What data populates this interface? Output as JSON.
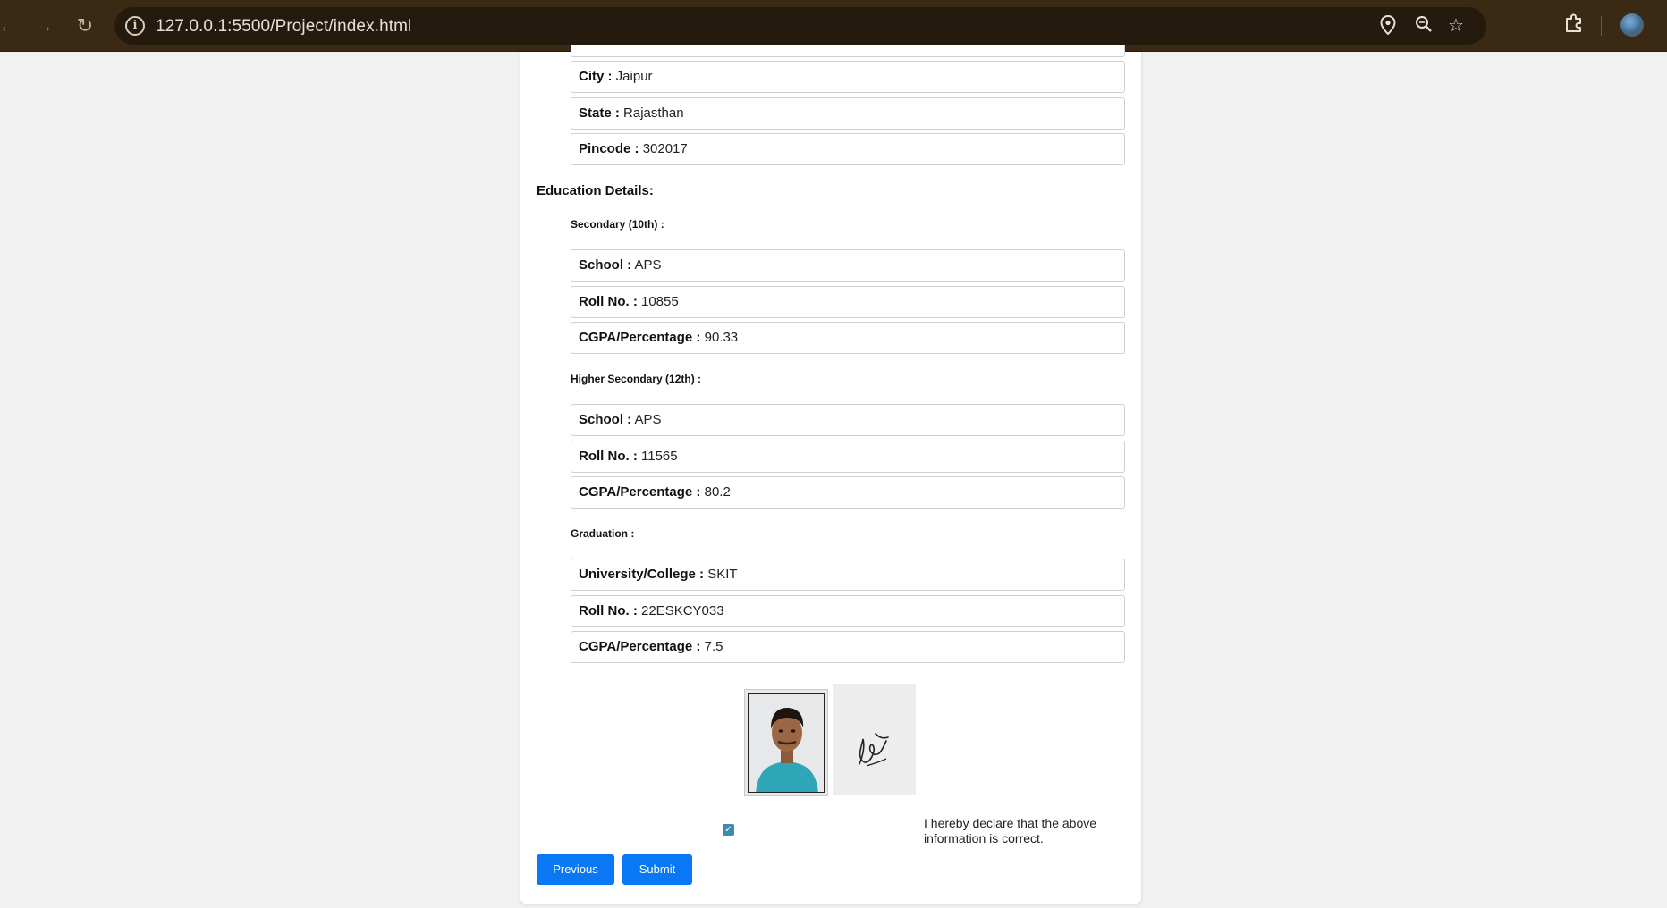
{
  "browser": {
    "url": "127.0.0.1:5500/Project/index.html",
    "icons": [
      "back-icon",
      "forward-icon",
      "reload-icon",
      "site-info-icon",
      "location-icon",
      "zoom-icon",
      "bookmark-star-icon",
      "extensions-icon",
      "profile-avatar"
    ]
  },
  "address": {
    "city_label": "City :",
    "city_value": "Jaipur",
    "state_label": "State :",
    "state_value": "Rajasthan",
    "pincode_label": "Pincode :",
    "pincode_value": "302017"
  },
  "education": {
    "title": "Education Details:",
    "secondary": {
      "title": "Secondary (10th) :",
      "school_label": "School :",
      "school_value": "APS",
      "roll_label": "Roll No. :",
      "roll_value": "10855",
      "cgpa_label": "CGPA/Percentage :",
      "cgpa_value": "90.33"
    },
    "higher_secondary": {
      "title": "Higher Secondary (12th) :",
      "school_label": "School :",
      "school_value": "APS",
      "roll_label": "Roll No. :",
      "roll_value": "11565",
      "cgpa_label": "CGPA/Percentage :",
      "cgpa_value": "80.2"
    },
    "graduation": {
      "title": "Graduation :",
      "university_label": "University/College :",
      "university_value": "SKIT",
      "roll_label": "Roll No. :",
      "roll_value": "22ESKCY033",
      "cgpa_label": "CGPA/Percentage :",
      "cgpa_value": "7.5"
    }
  },
  "declaration": {
    "checked": true,
    "text": "I hereby declare that the above information is correct."
  },
  "buttons": {
    "previous": "Previous",
    "submit": "Submit"
  },
  "colors": {
    "toolbar": "#3a2913",
    "primary_button": "#0a78f5",
    "checkbox": "#3b8cb0"
  }
}
